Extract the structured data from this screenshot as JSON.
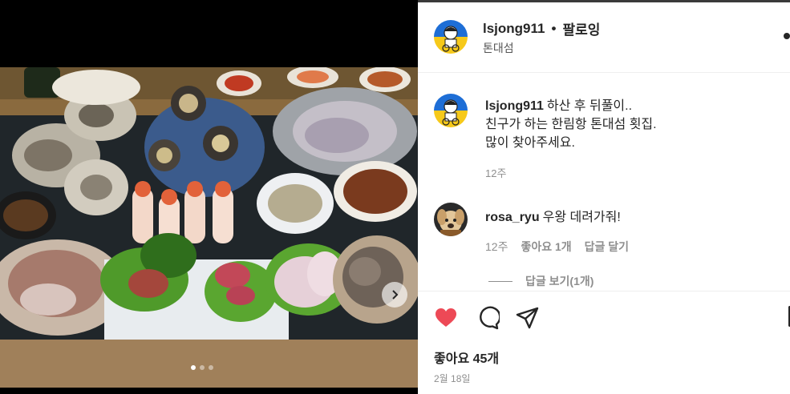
{
  "post": {
    "username": "lsjong911",
    "separator": "•",
    "follow_label": "팔로잉",
    "location": "톤대섬"
  },
  "caption": {
    "username": "lsjong911",
    "line1": "하산 후 뒤풀이..",
    "line2": "친구가 하는 한림항 톤대섬 횟집.",
    "line3": "많이 찾아주세요.",
    "time": "12주"
  },
  "comment": {
    "username": "rosa_ryu",
    "text": "우왕 데려가줘!",
    "time": "12주",
    "likes": "좋아요 1개",
    "reply_label": "답글 달기",
    "view_replies": "답글 보기(1개)"
  },
  "actions": {
    "likes_count": "좋아요 45개",
    "date": "2월 18일",
    "icons": [
      "heart-filled-icon",
      "comment-icon",
      "share-icon",
      "save-icon"
    ],
    "heart_color": "#ed4956"
  },
  "carousel": {
    "dot_count": 3,
    "active_index": 0
  }
}
